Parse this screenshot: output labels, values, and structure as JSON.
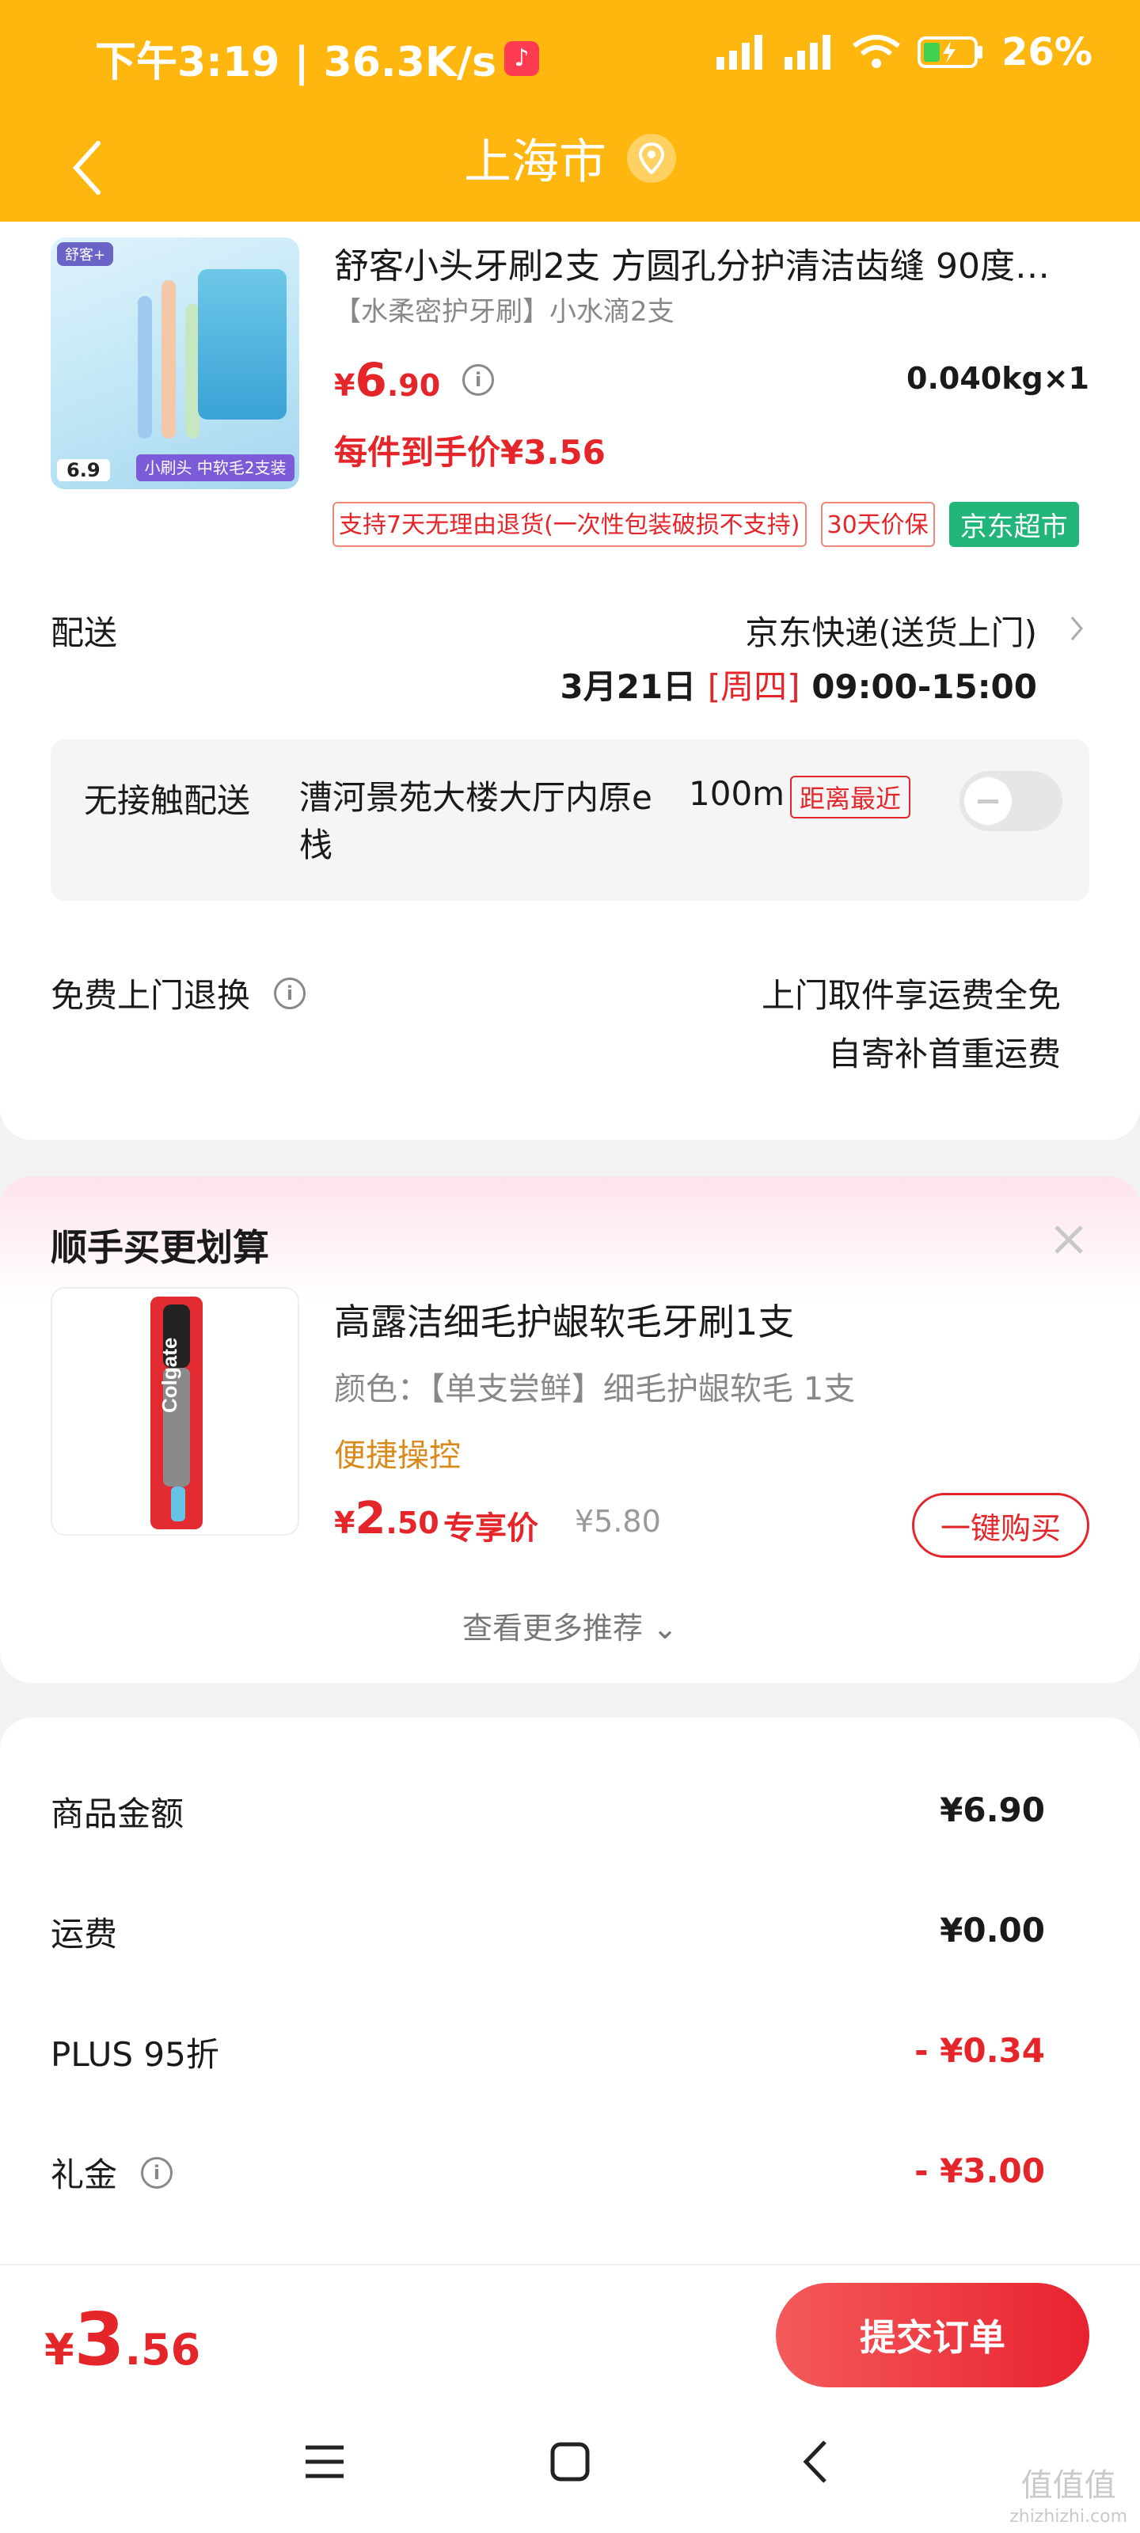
{
  "status_bar": {
    "time_speed": "下午3:19 | 36.3K/s",
    "battery": "26%"
  },
  "header": {
    "title": "上海市"
  },
  "product": {
    "title": "舒客小头牙刷2支 方圆孔分护清洁齿缝 90度…",
    "spec": "【水柔密护牙刷】小水滴2支",
    "price_yen": "¥",
    "price_int": "6",
    "price_dec": ".90",
    "weight": "0.040kg×1",
    "each_price": "每件到手价¥3.56",
    "tags": [
      "支持7天无理由退货(一次性包装破损不支持)",
      "30天价保",
      "京东超市"
    ],
    "image": {
      "brand": "舒客+",
      "price_chip": "6.9",
      "stripe": "小刷头 中软毛2支装"
    }
  },
  "delivery": {
    "label": "配送",
    "method": "京东快递(送货上门)",
    "date": "3月21日",
    "weekday": "[周四]",
    "time": "09:00-15:00"
  },
  "contactless": {
    "label": "无接触配送",
    "address": "漕河景苑大楼大厅内原e栈",
    "distance": "100m",
    "badge": "距离最近",
    "enabled": false
  },
  "returns": {
    "label": "免费上门退换",
    "line1": "上门取件享运费全免",
    "line2": "自寄补首重运费"
  },
  "recommend": {
    "title": "顺手买更划算",
    "name": "高露洁细毛护龈软毛牙刷1支",
    "spec": "颜色：【单支尝鲜】细毛护龈软毛 1支",
    "feature": "便捷操控",
    "price_yen": "¥",
    "price_int": "2",
    "price_dec": ".50",
    "price_label": "专享价",
    "orig_price": "¥5.80",
    "buy_label": "一键购买",
    "more_label": "查看更多推荐 ⌄",
    "image_brand": "Colgate"
  },
  "summary": {
    "rows": [
      {
        "label": "商品金额",
        "value": "¥6.90"
      },
      {
        "label": "运费",
        "value": "¥0.00"
      },
      {
        "label": "PLUS 95折",
        "value": "- ¥0.34"
      },
      {
        "label": "礼金",
        "value": "- ¥3.00"
      }
    ]
  },
  "footer": {
    "total_yen": "¥",
    "total_int": "3",
    "total_dec": ".56",
    "submit_label": "提交订单"
  },
  "watermark": {
    "text": "值值值",
    "url": "zhizhizhi.com"
  },
  "colors": {
    "header": "#ffb70f",
    "price_red": "#e4262a",
    "green_tag": "#21b57a",
    "feature_orange": "#d88a1b"
  },
  "icons": [
    "back-icon",
    "location-icon",
    "info-icon",
    "chevron-right-icon",
    "close-icon",
    "menu-icon",
    "home-icon",
    "nav-back-icon"
  ]
}
